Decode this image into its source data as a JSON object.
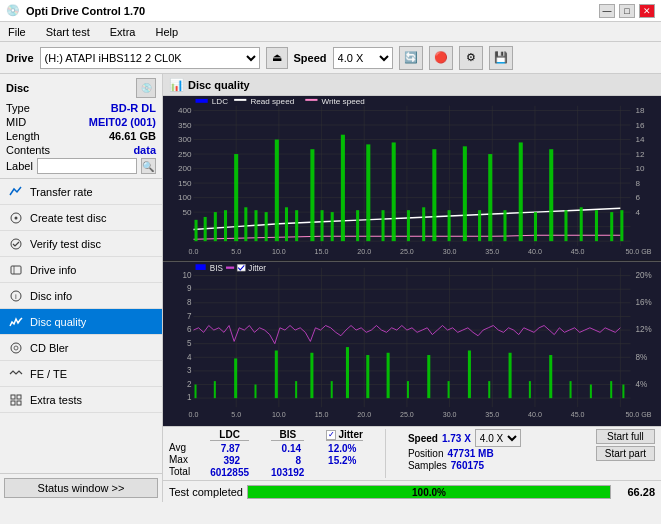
{
  "app": {
    "title": "Opti Drive Control 1.70",
    "icon": "disc-icon"
  },
  "title_buttons": {
    "minimize": "—",
    "maximize": "□",
    "close": "✕"
  },
  "menu": {
    "items": [
      "File",
      "Start test",
      "Extra",
      "Help"
    ]
  },
  "toolbar": {
    "drive_label": "Drive",
    "drive_value": "(H:) ATAPI iHBS112  2 CL0K",
    "speed_label": "Speed",
    "speed_value": "4.0 X"
  },
  "disc": {
    "title": "Disc",
    "type_label": "Type",
    "type_value": "BD-R DL",
    "mid_label": "MID",
    "mid_value": "MEIT02 (001)",
    "length_label": "Length",
    "length_value": "46.61 GB",
    "contents_label": "Contents",
    "contents_value": "data",
    "label_label": "Label",
    "label_value": ""
  },
  "nav": {
    "items": [
      {
        "id": "transfer-rate",
        "label": "Transfer rate",
        "icon": "chart-icon"
      },
      {
        "id": "create-test-disc",
        "label": "Create test disc",
        "icon": "disc-create-icon"
      },
      {
        "id": "verify-test-disc",
        "label": "Verify test disc",
        "icon": "verify-icon"
      },
      {
        "id": "drive-info",
        "label": "Drive info",
        "icon": "info-icon"
      },
      {
        "id": "disc-info",
        "label": "Disc info",
        "icon": "disc-info-icon"
      },
      {
        "id": "disc-quality",
        "label": "Disc quality",
        "icon": "quality-icon",
        "active": true
      },
      {
        "id": "cd-bler",
        "label": "CD Bler",
        "icon": "cd-icon"
      },
      {
        "id": "fe-te",
        "label": "FE / TE",
        "icon": "fe-icon"
      },
      {
        "id": "extra-tests",
        "label": "Extra tests",
        "icon": "extra-icon"
      }
    ]
  },
  "chart": {
    "title": "Disc quality",
    "legend": {
      "ldc": "LDC",
      "read_speed": "Read speed",
      "write_speed": "Write speed",
      "bis": "BIS",
      "jitter": "Jitter",
      "jitter_checked": true
    },
    "top_y_max": 400,
    "top_y_labels": [
      400,
      350,
      300,
      250,
      200,
      150,
      100,
      50
    ],
    "top_y2_labels": [
      18,
      16,
      14,
      12,
      10,
      8,
      6,
      4
    ],
    "bottom_y_max": 10,
    "bottom_y_labels": [
      10,
      9,
      8,
      7,
      6,
      5,
      4,
      3,
      2,
      1
    ],
    "bottom_y2_labels": [
      20,
      16,
      12,
      8,
      4
    ],
    "x_labels": [
      "0.0",
      "5.0",
      "10.0",
      "15.0",
      "20.0",
      "25.0",
      "30.0",
      "35.0",
      "40.0",
      "45.0",
      "50.0 GB"
    ]
  },
  "stats": {
    "ldc_header": "LDC",
    "bis_header": "BIS",
    "jitter_header": "Jitter",
    "speed_header": "Speed",
    "rows": {
      "avg": {
        "label": "Avg",
        "ldc": "7.87",
        "bis": "0.14",
        "jitter": "12.0%"
      },
      "max": {
        "label": "Max",
        "ldc": "392",
        "bis": "8",
        "jitter": "15.2%"
      },
      "total": {
        "label": "Total",
        "ldc": "6012855",
        "bis": "103192",
        "jitter": ""
      }
    },
    "speed_val": "1.73 X",
    "speed_select": "4.0 X",
    "position_label": "Position",
    "position_val": "47731 MB",
    "samples_label": "Samples",
    "samples_val": "760175",
    "start_full": "Start full",
    "start_part": "Start part"
  },
  "statusbar": {
    "window_btn": "Status window >>",
    "progress": 100.0,
    "progress_text": "100.0%",
    "status_text": "Test completed",
    "final_val": "66.28"
  }
}
